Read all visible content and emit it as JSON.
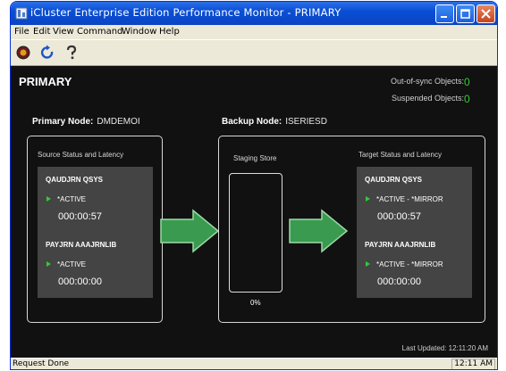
{
  "window": {
    "title": "iCluster Enterprise Edition Performance Monitor - PRIMARY"
  },
  "menu": [
    "File",
    "Edit",
    "View",
    "Command",
    "Window",
    "Help"
  ],
  "toolbar": [
    "connect-icon",
    "refresh-icon",
    "help-icon"
  ],
  "main": {
    "system_name": "PRIMARY",
    "out_of_sync_label": "Out-of-sync Objects:",
    "out_of_sync_value": "0",
    "suspended_label": "Suspended Objects:",
    "suspended_value": "0",
    "primary_node_label": "Primary Node:",
    "primary_node_value": "DMDEMOI",
    "backup_node_label": "Backup Node:",
    "backup_node_value": "ISERIESD",
    "source_title": "Source Status and Latency",
    "staging_title": "Staging Store",
    "staging_pct": "0%",
    "target_title": "Target Status and Latency",
    "source_journals": [
      {
        "name": "QAUDJRN   QSYS",
        "status": "*ACTIVE",
        "latency": "000:00:57"
      },
      {
        "name": "PAYJRN   AAAJRNLIB",
        "status": "*ACTIVE",
        "latency": "000:00:00"
      }
    ],
    "target_journals": [
      {
        "name": "QAUDJRN   QSYS",
        "status": "*ACTIVE - *MIRROR",
        "latency": "000:00:57"
      },
      {
        "name": "PAYJRN   AAAJRNLIB",
        "status": "*ACTIVE - *MIRROR",
        "latency": "000:00:00"
      }
    ],
    "last_updated": "Last Updated: 12:11:20 AM"
  },
  "statusbar": {
    "text": "Request Done",
    "time": "12:11 AM"
  },
  "colors": {
    "title_bar": "#0a4fd4",
    "background": "#111111",
    "status_green": "#2ed12e",
    "arrow_green": "#3a9a4f",
    "journal_box": "#444444"
  }
}
